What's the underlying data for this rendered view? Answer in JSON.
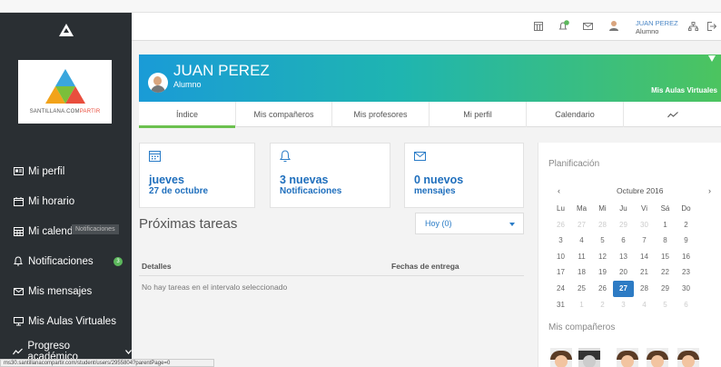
{
  "sidebar": {
    "brand_tagline_a": "SANTILLANA.COM",
    "brand_tagline_b": "PARTIR",
    "items": [
      {
        "label": "Mi perfil",
        "icon": "id-card-icon"
      },
      {
        "label": "Mi horario",
        "icon": "calendar-icon"
      },
      {
        "label": "Mi calendario",
        "icon": "calendar-grid-icon",
        "tooltip": "Notificaciones"
      },
      {
        "label": "Notificaciones",
        "icon": "bell-icon",
        "badge": "3"
      },
      {
        "label": "Mis mensajes",
        "icon": "envelope-icon"
      },
      {
        "label": "Mis Aulas Virtuales",
        "icon": "monitor-icon"
      },
      {
        "label": "Progreso académico",
        "icon": "trend-icon"
      }
    ]
  },
  "topbar": {
    "user_name": "JUAN PEREZ",
    "user_role": "Alumno",
    "notif_badge": "3"
  },
  "profile": {
    "name": "JUAN PEREZ",
    "role": "Alumno",
    "aulas_link": "Mis Aulas Virtuales"
  },
  "tabs": [
    "Índice",
    "Mis compañeros",
    "Mis profesores",
    "Mi perfil",
    "Calendario",
    "~"
  ],
  "cards": {
    "date": {
      "line1": "jueves",
      "line2": "27 de octubre"
    },
    "notifications": {
      "line1": "3 nuevas",
      "line2": "Notificaciones"
    },
    "messages": {
      "line1": "0 nuevos",
      "line2": "mensajes"
    }
  },
  "tareas": {
    "title": "Próximas tareas",
    "filter": "Hoy (0)",
    "col_details": "Detalles",
    "col_date": "Fechas de entrega",
    "empty": "No hay tareas en el intervalo seleccionado"
  },
  "planificacion": {
    "title": "Planificación",
    "month": "Octubre 2016",
    "prev": "‹",
    "next": "›",
    "weekdays": [
      "Lu",
      "Ma",
      "Mi",
      "Ju",
      "Vi",
      "Sá",
      "Do"
    ],
    "weeks": [
      [
        "26",
        "27",
        "28",
        "29",
        "30",
        "1",
        "2"
      ],
      [
        "3",
        "4",
        "5",
        "6",
        "7",
        "8",
        "9"
      ],
      [
        "10",
        "11",
        "12",
        "13",
        "14",
        "15",
        "16"
      ],
      [
        "17",
        "18",
        "19",
        "20",
        "21",
        "22",
        "23"
      ],
      [
        "24",
        "25",
        "26",
        "27",
        "28",
        "29",
        "30"
      ],
      [
        "31",
        "1",
        "2",
        "3",
        "4",
        "5",
        "6"
      ]
    ],
    "today": "27"
  },
  "companeros_title": "Mis compañeros",
  "status_url": "ms30.santillanacompartir.com/student/users/2955804?parentPage=0"
}
